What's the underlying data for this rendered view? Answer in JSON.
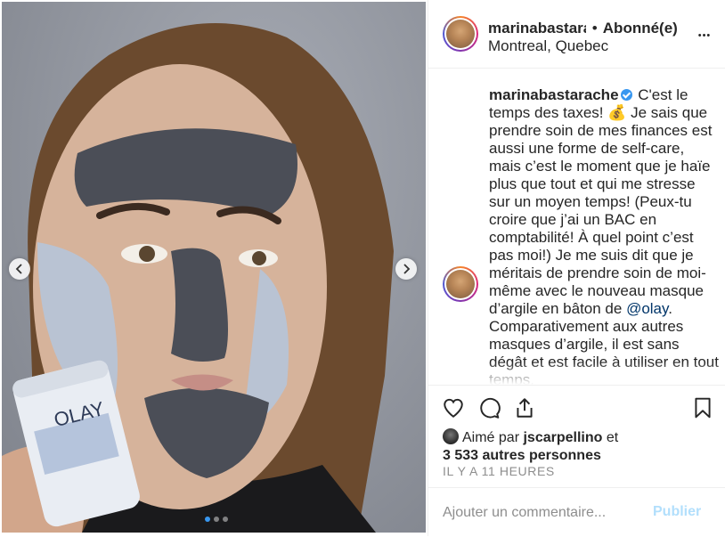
{
  "header": {
    "username": "marinabastarache",
    "separator": "•",
    "follow_status": "Abonné(e)",
    "location": "Montreal, Quebec",
    "more_label": "•••"
  },
  "caption": {
    "username": "marinabastarache",
    "text_part1": "C'est le temps des taxes! 💰 Je sais que prendre soin de mes finances est aussi une forme de self-care, mais c’est le moment que je haïe plus que tout et qui me stresse sur un moyen temps! (Peux-tu croire que j’ai un BAC en comptabilité! À quel point c’est pas moi!) Je me suis dit que je méritais de prendre soin de moi-même avec le nouveau masque d’argile en bâton de ",
    "mention": "@olay",
    "text_part2": ". Comparativement aux autres masques d’argile, il est sans dégât et est facile à utiliser en tout temps."
  },
  "likes": {
    "prefix": "Aimé par ",
    "first_user": "jscarpellino",
    "middle": " et",
    "others": "3 533 autres personnes"
  },
  "timestamp": "IL Y A 11 HEURES",
  "add_comment": {
    "placeholder": "Ajouter un commentaire...",
    "publish_label": "Publier"
  },
  "media": {
    "product_text": "OLAY",
    "carousel_count": 3,
    "carousel_active": 1
  },
  "colors": {
    "accent": "#3897f0",
    "publish_disabled": "#b2dffc",
    "muted": "#8e8e8e",
    "text": "#262626"
  }
}
